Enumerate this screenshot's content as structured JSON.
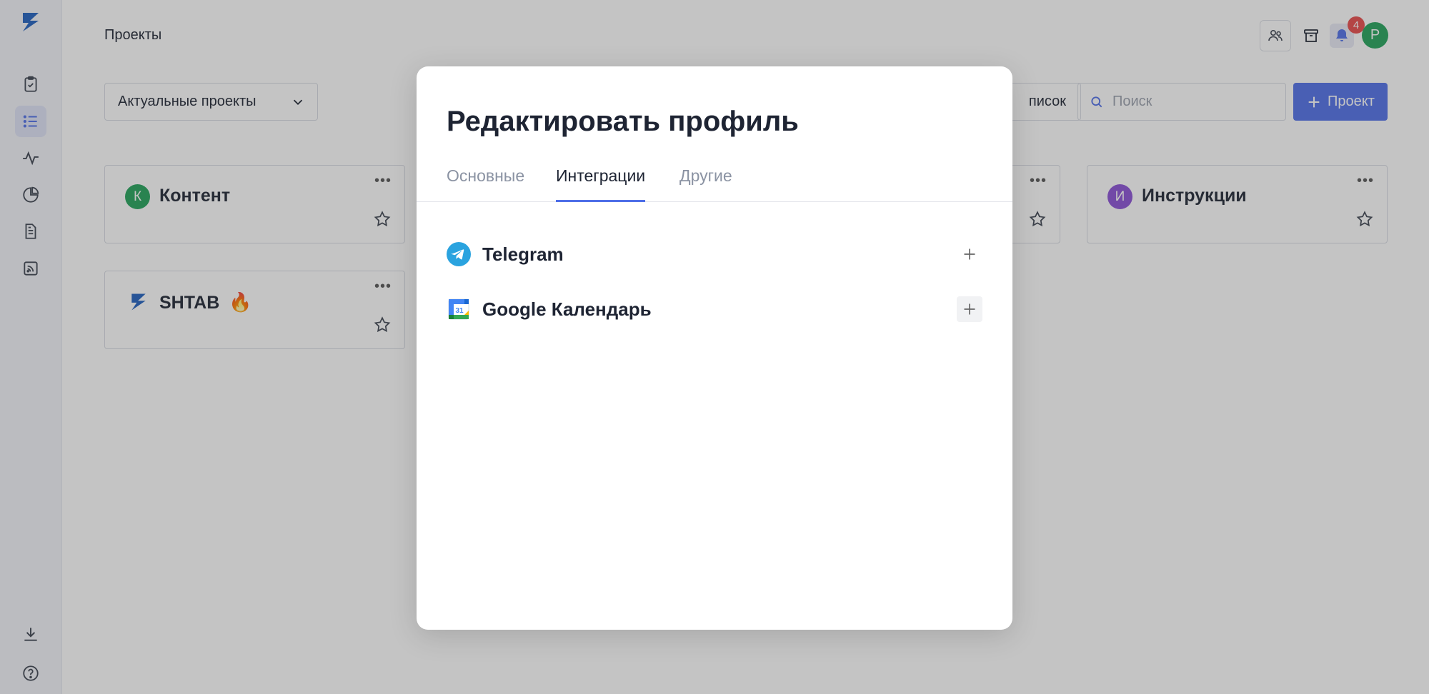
{
  "header": {
    "breadcrumb": "Проекты",
    "notification_count": "4",
    "user_initial": "Р"
  },
  "filters": {
    "select_value": "Актуальные проекты",
    "list_button_label": "писок",
    "search_placeholder": "Поиск",
    "add_project_label": "Проект"
  },
  "cards": [
    {
      "initial": "К",
      "title": "Контент",
      "color": "#22a35a"
    },
    {
      "initial": "",
      "title": "SHTAB",
      "color": "#1f5fbf",
      "emoji": "🔥"
    },
    {
      "initial": "И",
      "title": "Инструкции",
      "color": "#8a4fd6"
    }
  ],
  "modal": {
    "title": "Редактировать профиль",
    "tabs": [
      {
        "label": "Основные"
      },
      {
        "label": "Интеграции"
      },
      {
        "label": "Другие"
      }
    ],
    "active_tab": "Интеграции",
    "integrations": [
      {
        "name": "Telegram",
        "icon": "telegram-icon"
      },
      {
        "name": "Google Календарь",
        "icon": "google-calendar-icon"
      }
    ]
  },
  "colors": {
    "accent": "#4f6fe8",
    "sidebar_bg": "#f3f4f9",
    "badge": "#e84a4a"
  }
}
